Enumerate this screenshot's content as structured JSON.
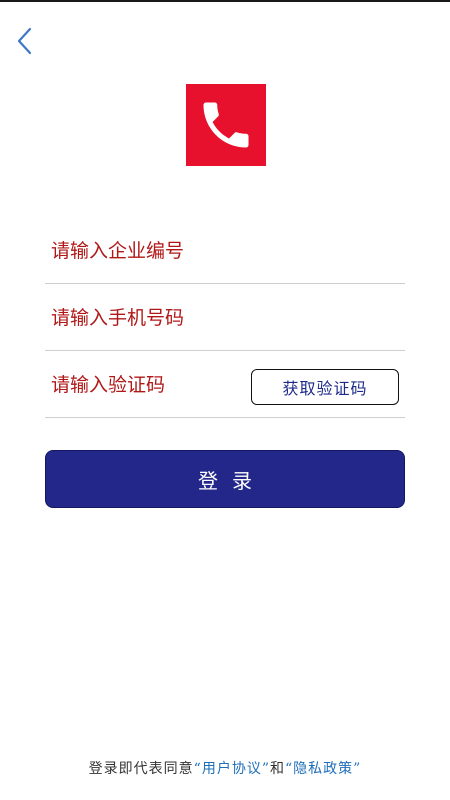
{
  "header": {
    "back_icon": "chevron-left-icon"
  },
  "logo": {
    "icon": "phone-icon",
    "background_color": "#e8112d"
  },
  "form": {
    "company_placeholder": "请输入企业编号",
    "phone_placeholder": "请输入手机号码",
    "code_placeholder": "请输入验证码",
    "get_code_label": "获取验证码",
    "login_label": "登录"
  },
  "agreement": {
    "prefix": "登录即代表同意",
    "user_agreement": "“用户协议”",
    "connector": "和",
    "privacy_policy": "“隐私政策”"
  },
  "colors": {
    "accent": "#23278a",
    "placeholder": "#b01818",
    "link": "#1f6fb8"
  }
}
